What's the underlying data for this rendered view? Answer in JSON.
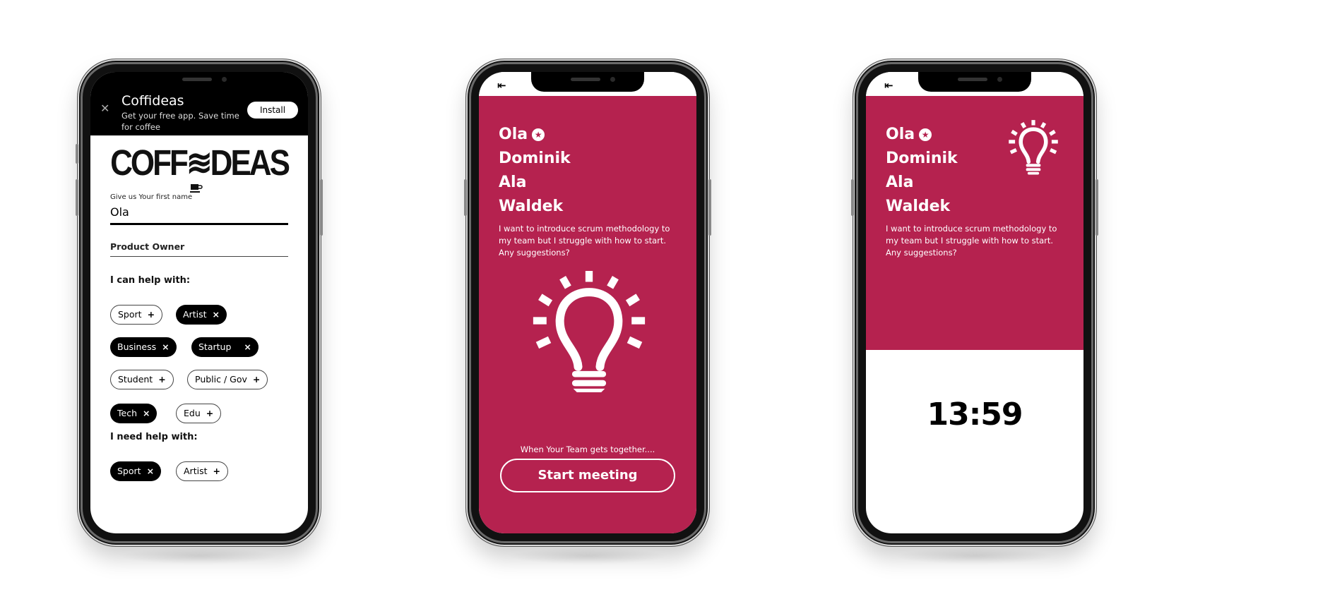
{
  "screens": {
    "registration": {
      "banner": {
        "close_icon": "close-icon",
        "app_name": "Coffideas",
        "subtitle": "Get your free app. Save time for coffee",
        "install_label": "Install"
      },
      "logo_text": "COFF≋DEAS",
      "first_name": {
        "label": "Give us Your first name",
        "value": "Ola"
      },
      "role": {
        "value": "Product Owner"
      },
      "can_help": {
        "heading": "I can help with:",
        "chips": [
          {
            "label": "Sport",
            "selected": false,
            "icon": "+"
          },
          {
            "label": "Artist",
            "selected": true,
            "icon": "×"
          },
          {
            "label": "Business",
            "selected": true,
            "icon": "×"
          },
          {
            "label": "Startup",
            "selected": true,
            "icon": "×"
          },
          {
            "label": "Student",
            "selected": false,
            "icon": "+"
          },
          {
            "label": "Public / Gov",
            "selected": false,
            "icon": "+"
          },
          {
            "label": "Tech",
            "selected": true,
            "icon": "×"
          },
          {
            "label": "Edu",
            "selected": false,
            "icon": "+"
          }
        ]
      },
      "need_help": {
        "heading": "I need help with:",
        "chips": [
          {
            "label": "Sport",
            "selected": true,
            "icon": "×"
          },
          {
            "label": "Artist",
            "selected": false,
            "icon": "+"
          }
        ]
      }
    },
    "team": {
      "back_icon": "⇤",
      "names": [
        "Ola",
        "Dominik",
        "Ala",
        "Waldek"
      ],
      "star_icon": "★",
      "question": "I want to introduce scrum methodology to my team but I struggle with how to start. Any suggestions?",
      "hint": "When Your Team gets together....",
      "start_label": "Start meeting"
    },
    "meeting": {
      "back_icon": "⇤",
      "names": [
        "Ola",
        "Dominik",
        "Ala",
        "Waldek"
      ],
      "star_icon": "★",
      "question": "I want to introduce scrum methodology to my team but I struggle with how to start. Any suggestions?",
      "timer": "13:59"
    }
  },
  "colors": {
    "accent": "#b5224f",
    "dark": "#000000",
    "light": "#ffffff"
  }
}
